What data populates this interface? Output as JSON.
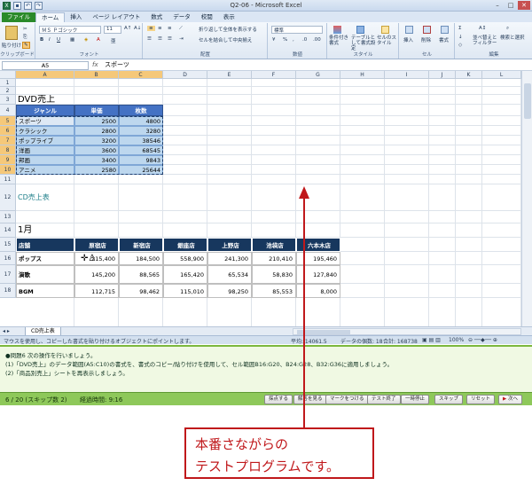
{
  "window": {
    "title": "Q2-06 - Microsoft Excel"
  },
  "tabs": [
    "ファイル",
    "ホーム",
    "挿入",
    "ページ レイアウト",
    "数式",
    "データ",
    "校閲",
    "表示"
  ],
  "ribbon": {
    "paste": "貼り付け",
    "clipboard": "クリップボード",
    "font_name": "ＭＳ Ｐゴシック",
    "font_size": "11",
    "font_group": "フォント",
    "wrap": "折り返して全体を表示する",
    "merge": "セルを結合して中央揃え",
    "align_group": "配置",
    "number_format": "標準",
    "number_group": "数値",
    "cond_format": "条件付き書式",
    "table_format": "テーブルとして書式設定",
    "cell_style": "セルのスタイル",
    "style_group": "スタイル",
    "insert": "挿入",
    "delete": "削除",
    "format": "書式",
    "cell_group": "セル",
    "sort": "並べ替えとフィルター",
    "find": "検索と選択",
    "edit_group": "編集"
  },
  "formula_bar": {
    "name_box": "A5",
    "fx": "fx",
    "value": "スポーツ"
  },
  "columns": [
    "A",
    "B",
    "C",
    "D",
    "E",
    "F",
    "G",
    "H",
    "I",
    "J",
    "K",
    "L"
  ],
  "rows": [
    "1",
    "2",
    "3",
    "4",
    "5",
    "6",
    "7",
    "8",
    "9",
    "10",
    "11",
    "12",
    "13",
    "14",
    "15",
    "16",
    "17",
    "18"
  ],
  "sheet": {
    "dvd_title": "DVD売上",
    "dvd_headers": [
      "ジャンル",
      "単価",
      "枚数"
    ],
    "dvd_rows": [
      [
        "スポーツ",
        "2500",
        "4800"
      ],
      [
        "クラシック",
        "2800",
        "3280"
      ],
      [
        "ポップライブ",
        "3200",
        "38546"
      ],
      [
        "洋画",
        "3600",
        "68545"
      ],
      [
        "邦画",
        "3400",
        "9843"
      ],
      [
        "アニメ",
        "2580",
        "25644"
      ]
    ],
    "cd_title": "CD売上表",
    "month": "1月",
    "cd_headers": [
      "店舗",
      "原宿店",
      "新宿店",
      "銀座店",
      "上野店",
      "池袋店",
      "六本木店"
    ],
    "cd_rows": [
      [
        "ポップス",
        "215,400",
        "184,500",
        "558,900",
        "241,300",
        "210,410",
        "195,460"
      ],
      [
        "演歌",
        "145,200",
        "88,565",
        "165,420",
        "65,534",
        "58,830",
        "127,840"
      ],
      [
        "BGM",
        "112,715",
        "98,462",
        "115,010",
        "98,250",
        "85,553",
        "8,000"
      ]
    ]
  },
  "sheet_tab": "CD売上表",
  "status": {
    "message": "マウスを使用し、コピーした書式を貼り付けるオブジェクトにポイントします。",
    "average": "平均: 14061.5",
    "count": "データの個数: 18",
    "sum": "合計: 168738",
    "zoom": "100%"
  },
  "question": {
    "line1": "●問題6 次の操作を行いましょう。",
    "line2": "(1)「DVD売上」のデータ範囲(A5:C10)の書式を、書式のコピー/貼り付けを使用して、セル範囲B16:G20、B24:G28、B32:G36に適用しましょう。",
    "line3": "(2)「商品別売上」シートを再表示しましょう。"
  },
  "footer": {
    "progress": "6 / 20 (スキップ数 2)",
    "elapsed": "経過時間: 9:16",
    "buttons": [
      "採点する",
      "解答を見る",
      "マークをつける",
      "テスト終了",
      "一時停止",
      "スキップ",
      "リセット",
      "次へ"
    ]
  },
  "callout": {
    "line1": "本番さながらの",
    "line2": "テストプログラムです。"
  },
  "colors": {
    "header_blue": "#4472c4",
    "cd_header": "#17375e",
    "dvd_row": "#bdd7ee",
    "callout": "#c0181b",
    "panel_green": "#8ec85a"
  }
}
